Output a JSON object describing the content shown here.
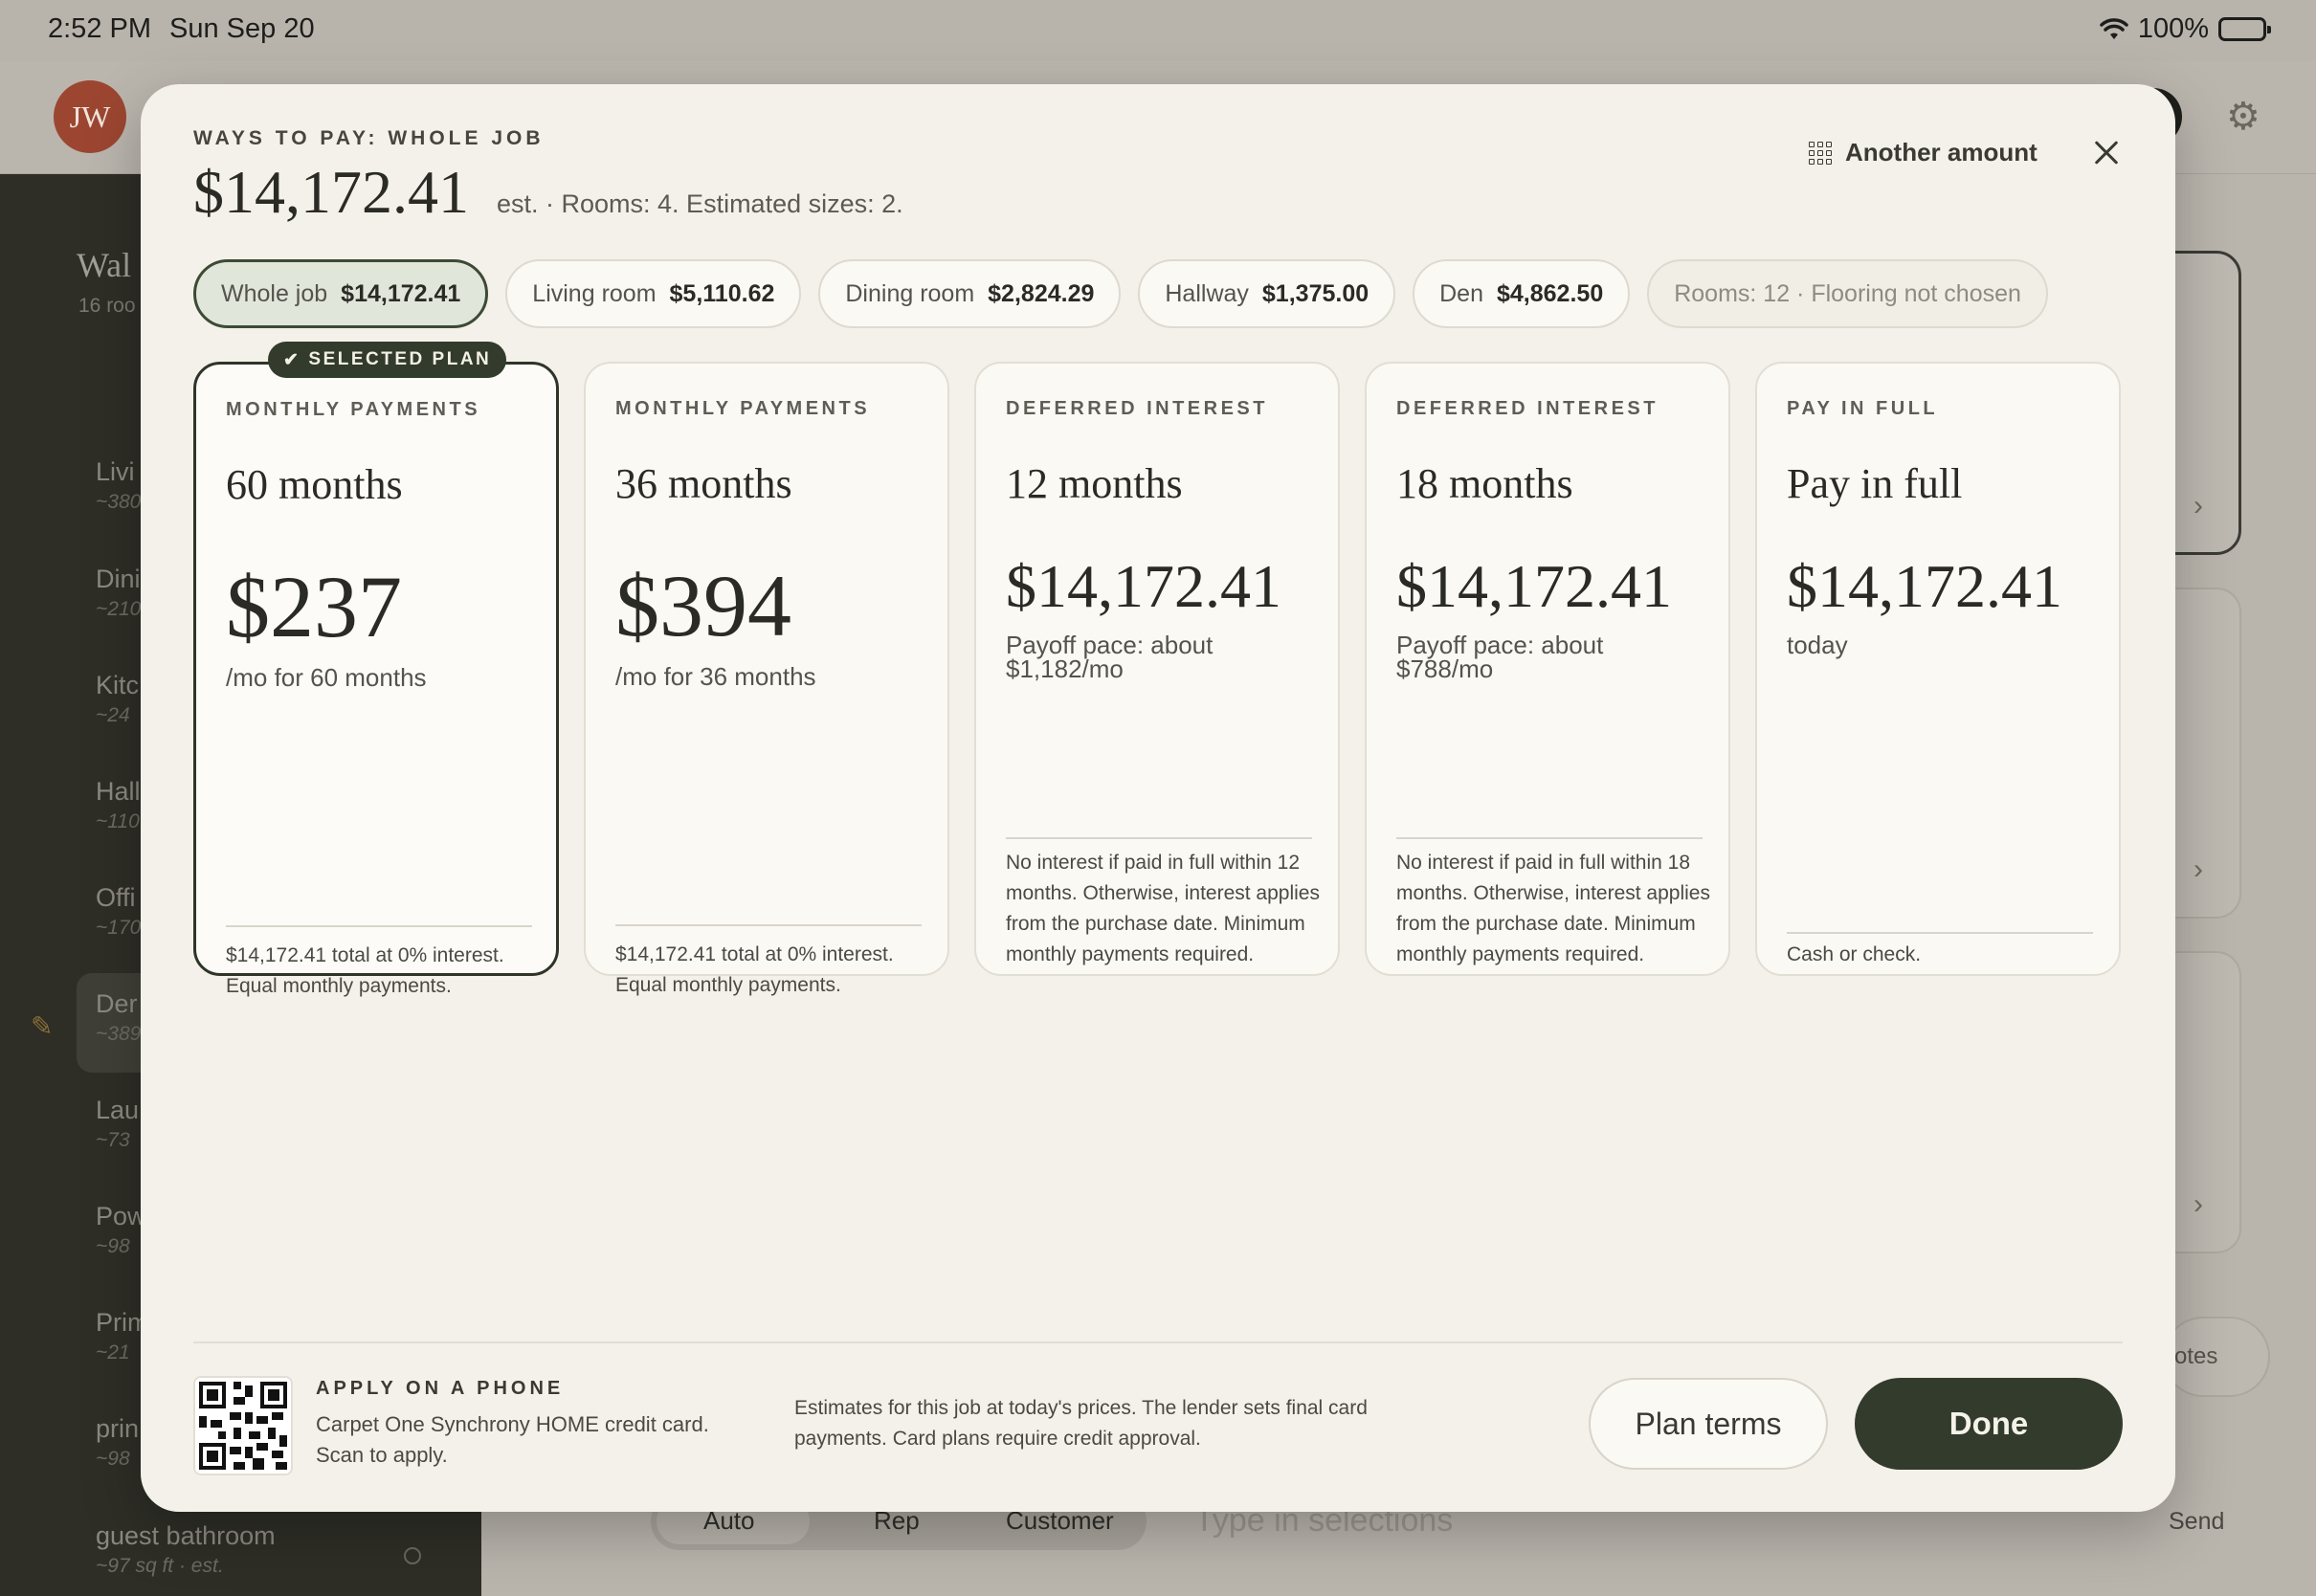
{
  "status": {
    "time": "2:52 PM",
    "date": "Sun Sep 20",
    "battery": "100%"
  },
  "app": {
    "avatar": "JW",
    "sidebar": {
      "title": "Wal",
      "subtitle": "16 roo",
      "items": [
        {
          "name": "Livi",
          "size": "~380"
        },
        {
          "name": "Dini",
          "size": "~210"
        },
        {
          "name": "Kitc",
          "size": "~24"
        },
        {
          "name": "Hall",
          "size": "~110"
        },
        {
          "name": "Offi",
          "size": "~170"
        },
        {
          "name": "Der",
          "size": "~389"
        },
        {
          "name": "Lau",
          "size": "~73"
        },
        {
          "name": "Pow",
          "size": "~98"
        },
        {
          "name": "Prim",
          "size": "~21"
        },
        {
          "name": "prin",
          "size": "~98"
        },
        {
          "name": "guest bathroom",
          "size": "~97 sq ft · est."
        }
      ]
    },
    "composer": {
      "segments": [
        "Auto",
        "Rep",
        "Customer"
      ],
      "placeholder": "Type in selections",
      "send": "Send",
      "notes": "otes"
    }
  },
  "modal": {
    "eyebrow": "WAYS TO PAY: WHOLE JOB",
    "total": "$14,172.41",
    "estimate_note": "est. · Rooms: 4. Estimated sizes: 2.",
    "another_amount": "Another amount",
    "chips": [
      {
        "label": "Whole job",
        "amount": "$14,172.41"
      },
      {
        "label": "Living room",
        "amount": "$5,110.62"
      },
      {
        "label": "Dining room",
        "amount": "$2,824.29"
      },
      {
        "label": "Hallway",
        "amount": "$1,375.00"
      },
      {
        "label": "Den",
        "amount": "$4,862.50"
      },
      {
        "label": "Rooms: 12 · Flooring not chosen",
        "amount": ""
      }
    ],
    "selected_badge": "SELECTED PLAN",
    "plans": [
      {
        "type": "MONTHLY PAYMENTS",
        "term": "60 months",
        "amount": "$237",
        "sub": "/mo for 60 months",
        "foot": "$14,172.41 total at 0% interest. Equal monthly payments."
      },
      {
        "type": "MONTHLY PAYMENTS",
        "term": "36 months",
        "amount": "$394",
        "sub": "/mo for 36 months",
        "foot": "$14,172.41 total at 0% interest. Equal monthly payments."
      },
      {
        "type": "DEFERRED INTEREST",
        "term": "12 months",
        "amount": "$14,172.41",
        "sub": "Payoff pace: about $1,182/mo",
        "foot": "No interest if paid in full within 12 months. Otherwise, interest applies from the purchase date. Minimum monthly payments required."
      },
      {
        "type": "DEFERRED INTEREST",
        "term": "18 months",
        "amount": "$14,172.41",
        "sub": "Payoff pace: about $788/mo",
        "foot": "No interest if paid in full within 18 months. Otherwise, interest applies from the purchase date. Minimum monthly payments required."
      },
      {
        "type": "PAY IN FULL",
        "term": "Pay in full",
        "amount": "$14,172.41",
        "sub": "today",
        "foot": "Cash or check."
      }
    ],
    "apply": {
      "eyebrow": "APPLY ON A PHONE",
      "text": "Carpet One Synchrony HOME credit card. Scan to apply."
    },
    "disclaimer": "Estimates for this job at today's prices. The lender sets final card payments. Card plans require credit approval.",
    "plan_terms": "Plan terms",
    "done": "Done"
  }
}
